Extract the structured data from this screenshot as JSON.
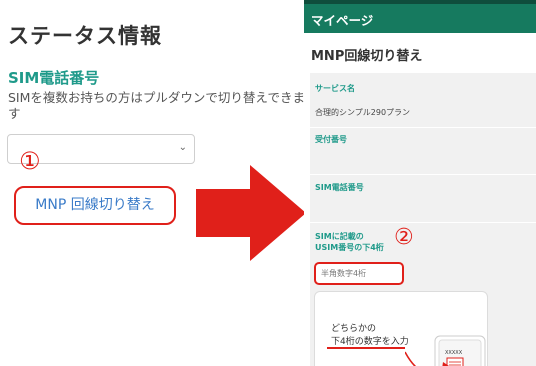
{
  "left": {
    "title": "ステータス情報",
    "section": "SIM電話番号",
    "desc_line1": "SIMを複数お持ちの方はプルダウンで切り替えできま",
    "desc_line2": "す",
    "select_value": "",
    "step1": "①",
    "mnp_button": "MNP 回線切り替え"
  },
  "right": {
    "header": "マイページ",
    "title": "MNP回線切り替え",
    "service_label": "サービス名",
    "service_value": "合理的シンプル290プラン",
    "reception_label": "受付番号",
    "sim_phone_label": "SIM電話番号",
    "usim_label_1": "SIMに記載の",
    "usim_label_2": "USIM番号の下4桁",
    "step2": "②",
    "input_placeholder": "半角数字4桁",
    "help_line1": "どちらかの",
    "help_line2": "下4桁の数字を入力",
    "card_code": "XXXXX"
  },
  "colors": {
    "header_green": "#167a5f",
    "label_teal": "#1f9a8a",
    "annotation_red": "#e0201a",
    "link_blue": "#3a7bc8"
  }
}
